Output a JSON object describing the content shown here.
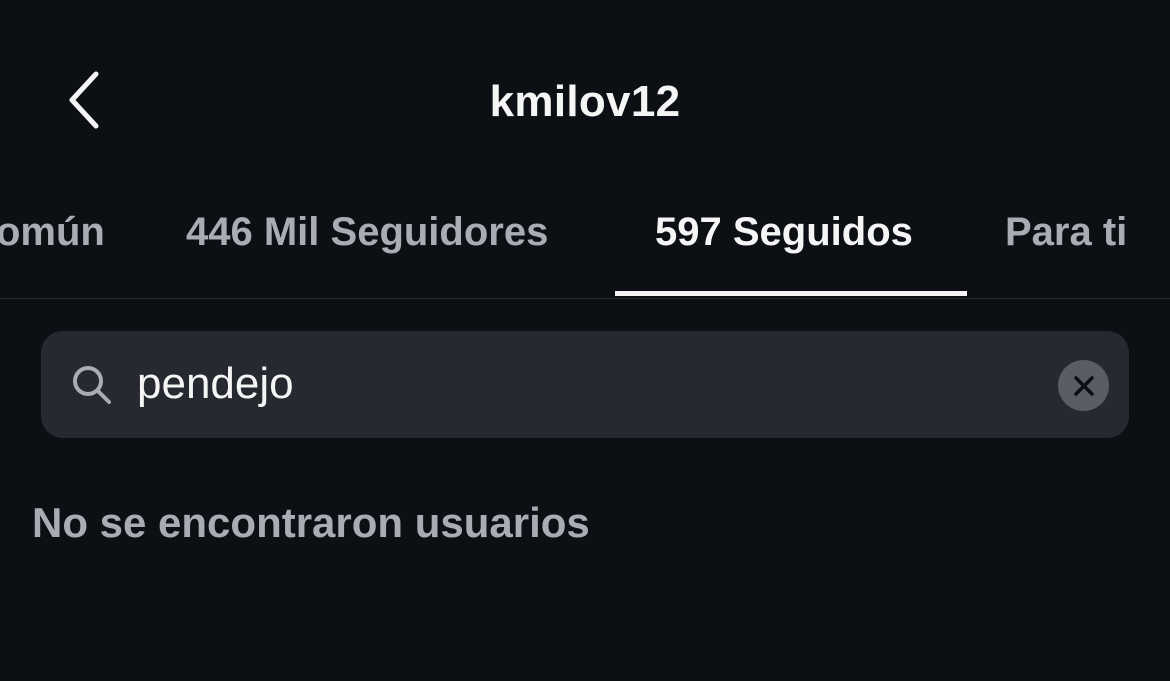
{
  "header": {
    "title": "kmilov12",
    "back_icon": "chevron-left-icon"
  },
  "tabs": [
    {
      "label": "omún",
      "active": false
    },
    {
      "label": "446 Mil Seguidores",
      "active": false
    },
    {
      "label": "597 Seguidos",
      "active": true
    },
    {
      "label": "Para ti",
      "active": false
    }
  ],
  "search": {
    "value": "pendejo",
    "icon": "search-icon",
    "clear_icon": "close-icon"
  },
  "results": {
    "empty_message": "No se encontraron usuarios"
  },
  "colors": {
    "background": "#0c1014",
    "text_primary": "#f5f5f5",
    "text_secondary": "#a8adb3",
    "search_bg": "#262a30"
  }
}
